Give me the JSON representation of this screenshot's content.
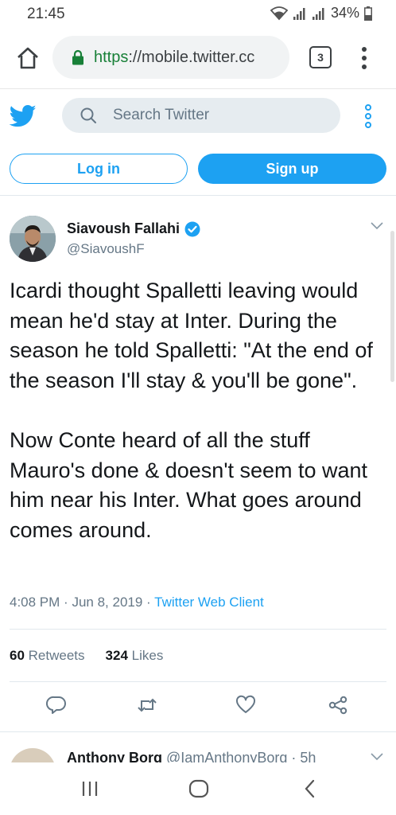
{
  "status_bar": {
    "time": "21:45",
    "battery": "34%"
  },
  "browser": {
    "url_scheme": "https",
    "url_rest": "://mobile.twitter.cc",
    "tab_count": "3"
  },
  "header": {
    "search_placeholder": "Search Twitter",
    "login_label": "Log in",
    "signup_label": "Sign up"
  },
  "tweet": {
    "author_name": "Siavoush Fallahi",
    "author_handle": "@SiavoushF",
    "text": "Icardi thought Spalletti leaving would mean he'd stay at Inter. During the season he told Spalletti: \"At the end of the season I'll stay & you'll be gone\".\n\nNow Conte heard of all the stuff Mauro's done & doesn't seem to want him near his Inter. What goes around comes around.",
    "time": "4:08 PM",
    "separator": "·",
    "date": "Jun 8, 2019",
    "client": "Twitter Web Client",
    "retweets_count": "60",
    "retweets_label": "Retweets",
    "likes_count": "324",
    "likes_label": "Likes"
  },
  "next_tweet": {
    "author_name": "Anthony Borg",
    "author_handle": "@IamAnthonyBorg · 5h"
  },
  "colors": {
    "twitter_blue": "#1da1f2",
    "secure_green": "#188038",
    "muted_text": "#657786"
  },
  "icons": [
    "home-icon",
    "lock-icon",
    "tabs-icon",
    "menu-icon",
    "twitter-bird-icon",
    "search-icon",
    "more-icon",
    "verified-icon",
    "chevron-down-icon",
    "reply-icon",
    "retweet-icon",
    "like-icon",
    "share-icon",
    "recents-icon",
    "home-circle-icon",
    "back-icon"
  ]
}
